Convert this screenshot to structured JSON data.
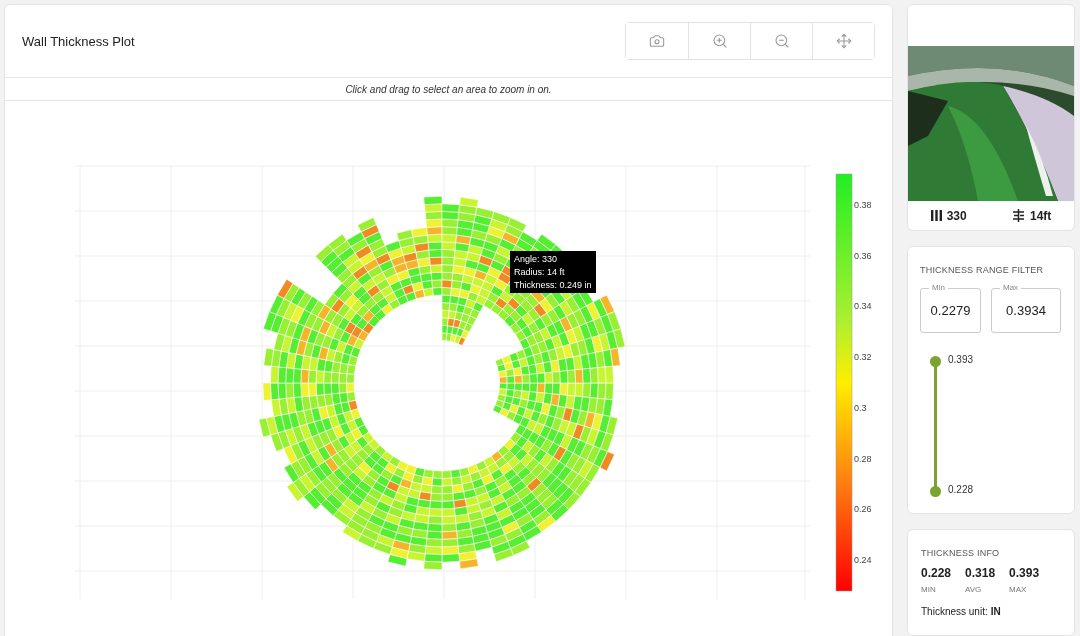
{
  "plot": {
    "title": "Wall Thickness Plot",
    "hint": "Click and drag to select an area to zoom in on.",
    "toolbar": [
      {
        "kind": "camera"
      },
      {
        "kind": "zoom_in"
      },
      {
        "kind": "zoom_out"
      },
      {
        "kind": "pan"
      }
    ],
    "tooltip": [
      "Angle: 330",
      "Radius: 14 ft",
      "Thickness: 0.249 in"
    ],
    "colorbar_ticks": [
      "0.38",
      "0.36",
      "0.34",
      "0.32",
      "0.3",
      "0.28",
      "0.26",
      "0.24"
    ]
  },
  "camera": {
    "angle": "330",
    "depth": "14ft"
  },
  "range_filter": {
    "title": "THICKNESS RANGE FILTER",
    "min_label": "Min",
    "min_value": "0.2279",
    "max_label": "Max",
    "max_value": "0.3934",
    "upper": {
      "label": "0.393",
      "level": 1
    },
    "lower": {
      "label": "0.228",
      "level": 0
    }
  },
  "info": {
    "title": "THICKNESS INFO",
    "stats": [
      {
        "value": "0.228",
        "label": "MIN"
      },
      {
        "value": "0.318",
        "label": "AVG"
      },
      {
        "value": "0.393",
        "label": "MAX"
      }
    ],
    "unit_label": "Thickness unit:",
    "unit": "IN"
  }
}
